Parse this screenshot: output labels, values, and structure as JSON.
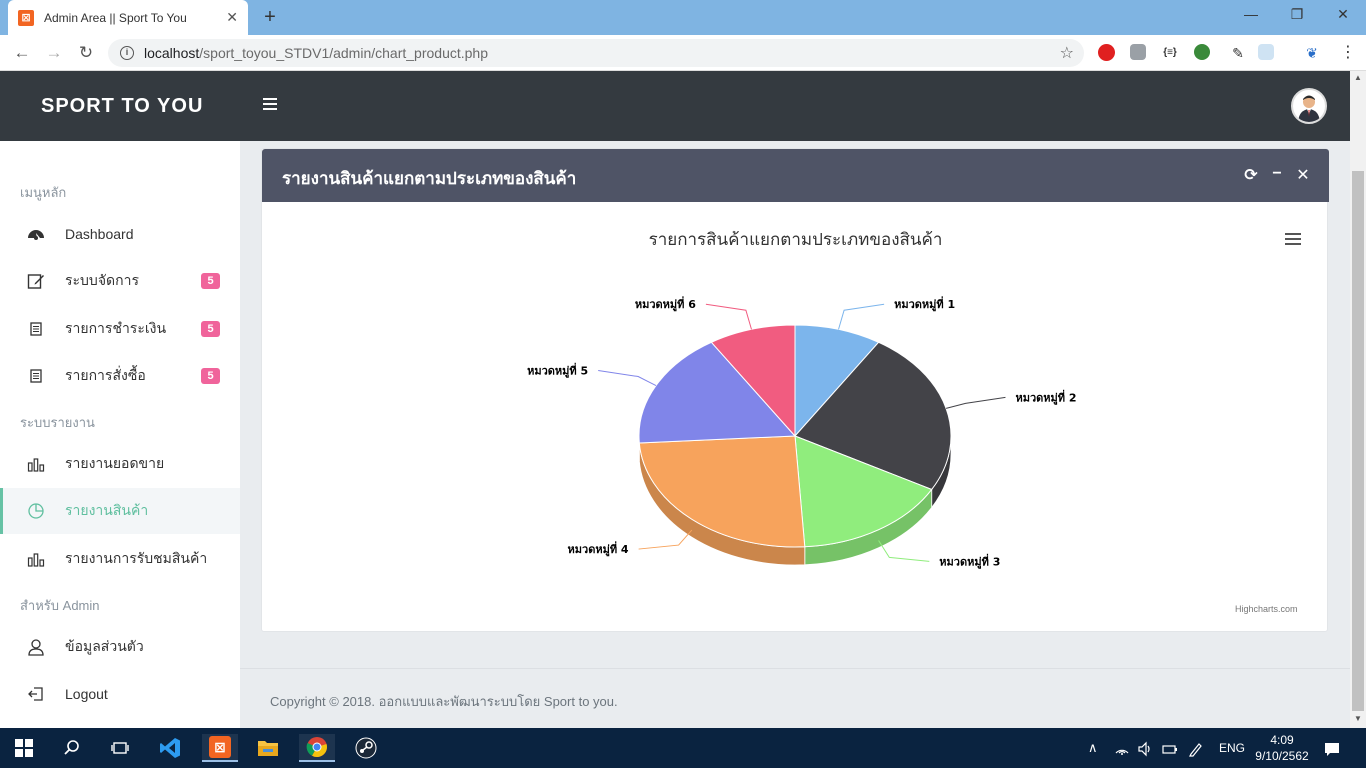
{
  "browser": {
    "tab_title": "Admin Area || Sport To You",
    "url_host": "localhost",
    "url_path": "/sport_toyou_STDV1/admin/chart_product.php"
  },
  "header": {
    "brand": "SPORT TO YOU"
  },
  "sidebar": {
    "section_main": "เมนูหลัก",
    "section_reports": "ระบบรายงาน",
    "section_admin": "สำหรับ Admin",
    "items": [
      {
        "label": "Dashboard",
        "icon": "dashboard-icon"
      },
      {
        "label": "ระบบจัดการ",
        "icon": "edit-icon",
        "badge": "5"
      },
      {
        "label": "รายการชำระเงิน",
        "icon": "document-icon",
        "badge": "5"
      },
      {
        "label": "รายการสั่งซื้อ",
        "icon": "document-icon",
        "badge": "5"
      },
      {
        "label": "รายงานยอดขาย",
        "icon": "bar-chart-icon"
      },
      {
        "label": "รายงานสินค้า",
        "icon": "pie-chart-icon",
        "active": true
      },
      {
        "label": "รายงานการรับชมสินค้า",
        "icon": "bar-chart-icon"
      },
      {
        "label": "ข้อมูลส่วนตัว",
        "icon": "user-icon"
      },
      {
        "label": "Logout",
        "icon": "logout-icon"
      }
    ]
  },
  "card": {
    "title": "รายงานสินค้าแยกตามประเภทของสินค้า"
  },
  "chart_data": {
    "type": "pie",
    "title": "รายการสินค้าแยกตามประเภทของสินค้า",
    "categories": [
      "หมวดหมู่ที่ 1",
      "หมวดหมู่ที่ 2",
      "หมวดหมู่ที่ 3",
      "หมวดหมู่ที่ 4",
      "หมวดหมู่ที่ 5",
      "หมวดหมู่ที่ 6"
    ],
    "values": [
      9,
      24,
      16,
      25,
      17,
      9
    ],
    "colors": [
      "#7cb5ec",
      "#434348",
      "#90ed7d",
      "#f7a35c",
      "#8085e9",
      "#f15c80"
    ],
    "credits": "Highcharts.com",
    "three_d": true
  },
  "footer": {
    "text": "Copyright © 2018. ออกแบบและพัฒนาระบบโดย Sport to you."
  },
  "taskbar": {
    "lang": "ENG",
    "time": "4:09",
    "date": "9/10/2562"
  }
}
